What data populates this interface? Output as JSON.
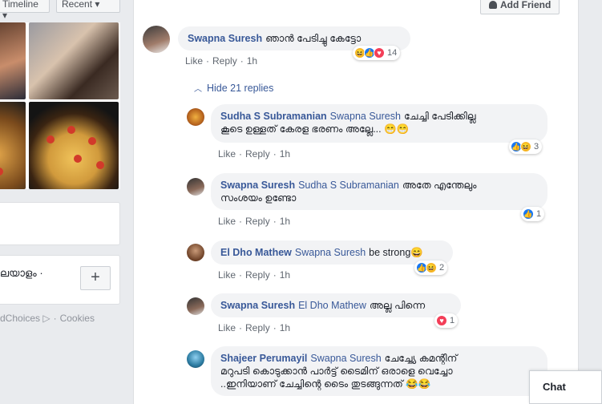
{
  "left": {
    "top_controls": [
      "Timeline ▾",
      "Recent ▾"
    ],
    "language_text": "ലയാളം ·",
    "add_label": "+",
    "footer_links": [
      "dChoices ▷",
      "·",
      "Cookies"
    ]
  },
  "header": {
    "add_friend_label": "Add Friend"
  },
  "main_comment": {
    "author": "Swapna Suresh",
    "text": "ഞാൻ പേടിച്ചു കേട്ടോ",
    "actions": [
      "Like",
      "·",
      "Reply",
      "·",
      "1h"
    ],
    "reaction_count": "14"
  },
  "hide_replies_label": "Hide 21 replies",
  "replies": [
    {
      "author": "Sudha S Subramanian",
      "tag": "Swapna Suresh",
      "text_line1": "ചേച്ചി പേടിക്കില്ല",
      "text_line2": "കൂടെ ഉള്ളത് കേരള ഭരണം അല്ലേ... 😁😁",
      "actions": [
        "Like",
        "·",
        "Reply",
        "·",
        "1h"
      ],
      "reaction_count": "3"
    },
    {
      "author": "Swapna Suresh",
      "tag": "Sudha S Subramanian",
      "text_line1": "അതേ എന്തേലും",
      "text_line2": "സംശയം ഉണ്ടോ",
      "actions": [
        "Like",
        "·",
        "Reply",
        "·",
        "1h"
      ],
      "reaction_count": "1"
    },
    {
      "author": "El Dho Mathew",
      "tag": "Swapna Suresh",
      "text_line1": "be strong😄",
      "actions": [
        "Like",
        "·",
        "Reply",
        "·",
        "1h"
      ],
      "reaction_count": "2"
    },
    {
      "author": "Swapna Suresh",
      "tag": "El Dho Mathew",
      "text_line1": "അല്ല പിന്നെ",
      "actions": [
        "Like",
        "·",
        "Reply",
        "·",
        "1h"
      ],
      "reaction_count": "1"
    },
    {
      "author": "Shajeer Perumayil",
      "tag": "Swapna Suresh",
      "text_line1": "ചേച്ച്യേ കമന്റിന്",
      "text_line2": "മറുപടി കൊടുക്കാൻ പാർട്ട് ടൈമിന് ഒരാളെ വെച്ചോ",
      "text_line3": "..ഇനിയാണ് ചേച്ചിന്റെ ടൈം തുടങ്ങുന്നത് 😂😂"
    }
  ],
  "chat": {
    "label": "Chat"
  },
  "colors": {
    "link": "#385898",
    "bubble": "#f2f3f5",
    "like": "#1877f2",
    "haha": "#f7b928",
    "love": "#f33e58"
  },
  "icons": [
    "add-friend-icon",
    "chevron-up-icon",
    "like-icon",
    "haha-icon",
    "love-icon",
    "ad-choices-icon"
  ]
}
